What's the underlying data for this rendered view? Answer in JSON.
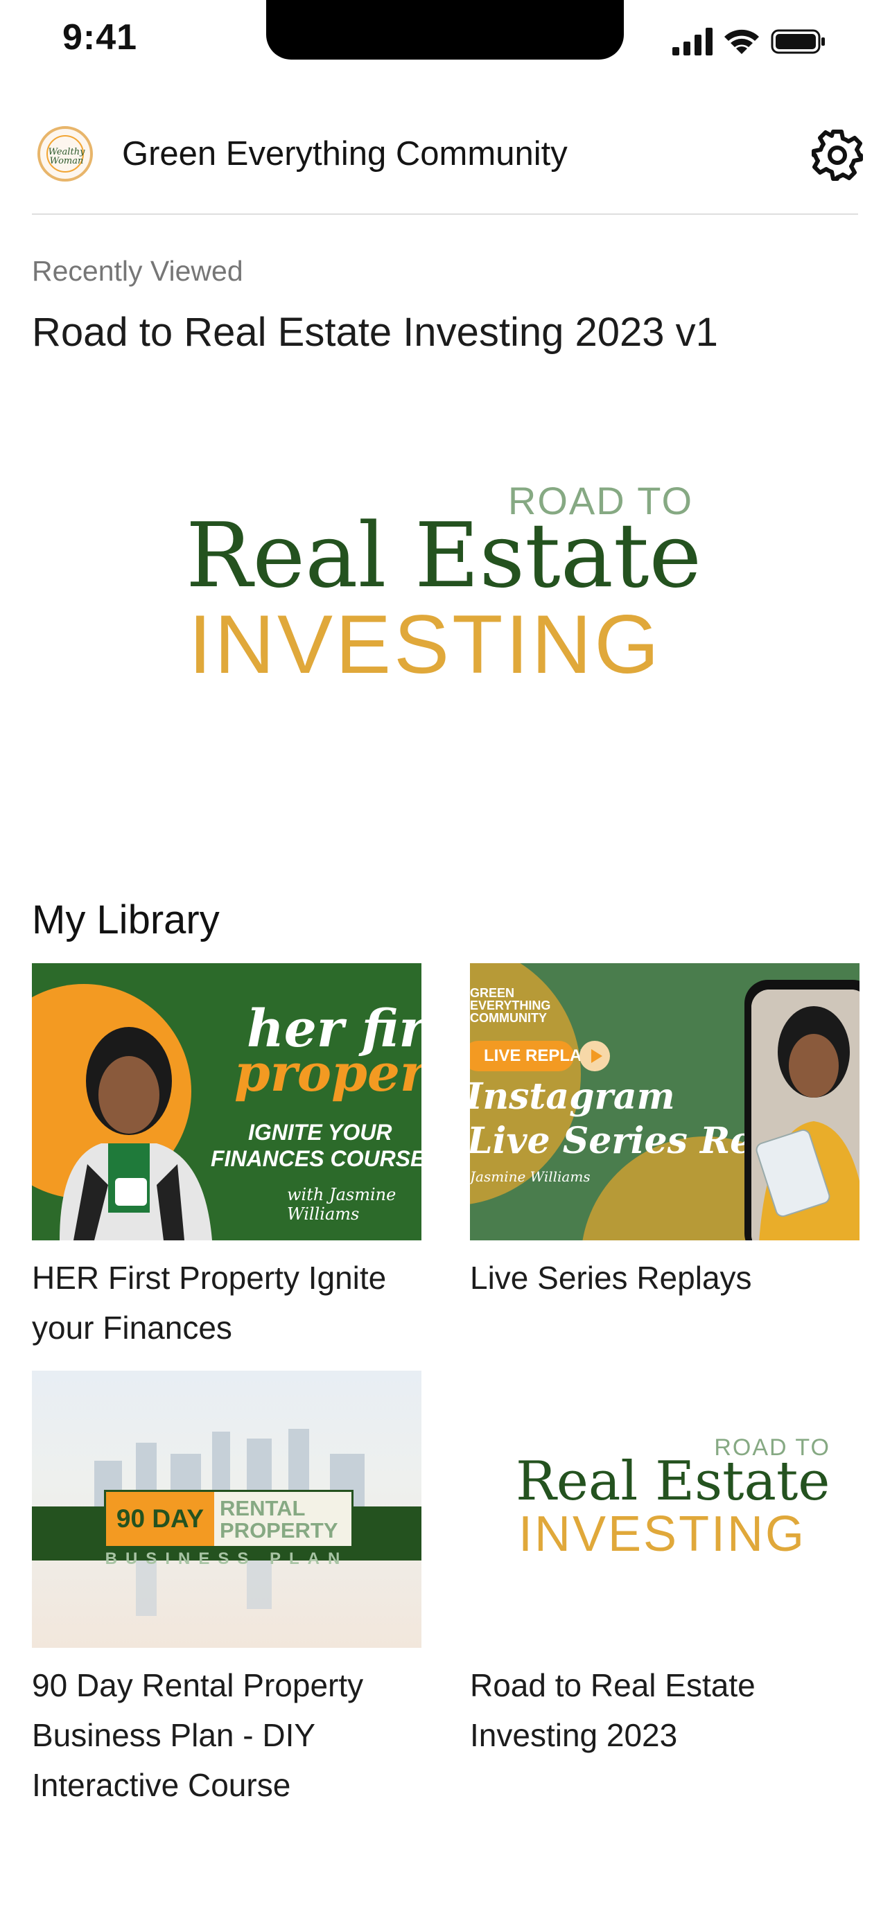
{
  "status_bar": {
    "time": "9:41"
  },
  "header": {
    "avatar_text": "Wealthy Woman",
    "title": "Green Everything Community"
  },
  "recently_viewed": {
    "label": "Recently Viewed",
    "title": "Road to Real Estate Investing 2023 v1",
    "logo": {
      "line1": "ROAD TO",
      "line2": "Real Estate",
      "line3": "INVESTING"
    }
  },
  "library": {
    "heading": "My Library",
    "items": [
      {
        "title": "HER First Property Ignite your Finances",
        "thumb": {
          "line1": "her first",
          "line2": "property",
          "line3": "IGNITE YOUR",
          "line4": "FINANCES COURSE",
          "signature": "with Jasmine Williams"
        }
      },
      {
        "title": "Live Series Replays",
        "thumb": {
          "brand": "GREEN EVERYTHING COMMUNITY",
          "pill": "LIVE REPLAY",
          "line1": "Instagram",
          "line2": "Live Series Replays",
          "signature": "Jasmine Williams"
        }
      },
      {
        "title": "90 Day Rental Property Business Plan - DIY Interactive Course",
        "thumb": {
          "badge": "90 DAY",
          "line1": "RENTAL",
          "line2": "PROPERTY",
          "line3": "BUSINESS PLAN"
        }
      },
      {
        "title": "Road to Real Estate Investing 2023",
        "thumb": {
          "line1": "ROAD TO",
          "line2": "Real Estate",
          "line3": "INVESTING"
        }
      }
    ]
  },
  "colors": {
    "brand_green": "#24521f",
    "accent_orange": "#f39a22",
    "gold": "#e0a83a",
    "sage": "#86a983"
  },
  "icons": [
    "signal-icon",
    "wifi-icon",
    "battery-icon",
    "gear-icon",
    "avatar-logo"
  ]
}
